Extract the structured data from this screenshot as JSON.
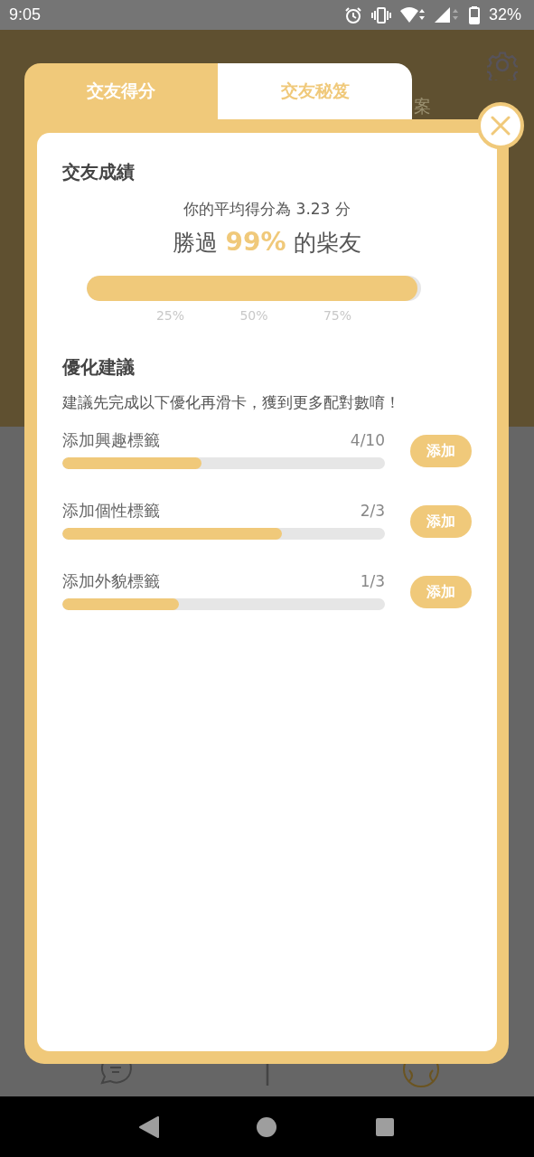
{
  "status_bar": {
    "time": "9:05",
    "battery": "32%"
  },
  "background": {
    "tab_label": "案"
  },
  "modal": {
    "tabs": [
      {
        "label": "交友得分",
        "selected": true
      },
      {
        "label": "交友秘笈",
        "selected": false
      }
    ],
    "score": {
      "title": "交友成績",
      "average": "你的平均得分為 3.23 分",
      "beat_prefix": "勝過",
      "beat_percent": "99%",
      "beat_suffix": "的柴友",
      "level": 0.99,
      "ticks": [
        "25%",
        "50%",
        "75%"
      ]
    },
    "advice": {
      "title": "優化建議",
      "description": "建議先完成以下優化再滑卡，獲到更多配對數唷！",
      "items": [
        {
          "label": "添加興趣標籤",
          "count": "4/10",
          "level": 0.43,
          "button": "添加"
        },
        {
          "label": "添加個性標籤",
          "count": "2/3",
          "level": 0.68,
          "button": "添加"
        },
        {
          "label": "添加外貌標籤",
          "count": "1/3",
          "level": 0.36,
          "button": "添加"
        }
      ]
    }
  }
}
